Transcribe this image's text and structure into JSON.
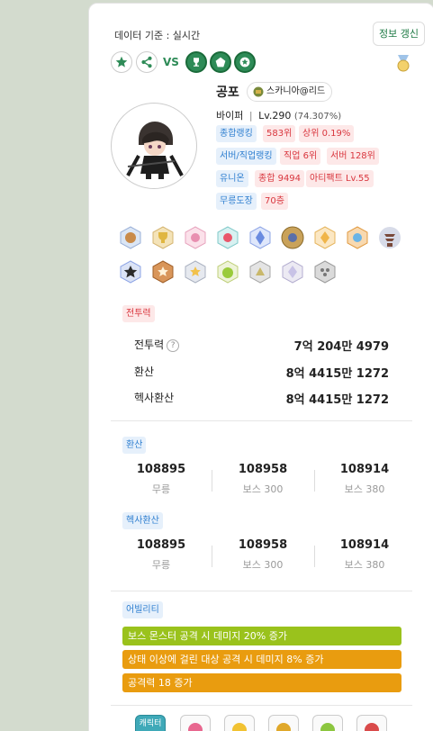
{
  "header": {
    "data_basis": "데이터 기준 : 실시간",
    "refresh_label": "정보 갱신",
    "vs_label": "VS"
  },
  "character": {
    "name": "공포",
    "guild": "스카니아@리드",
    "job": "바이퍼",
    "level": "Lv.290",
    "exp_pct": "(74.307%)"
  },
  "rankings": {
    "overall_label": "종합랭킹",
    "overall_value": "583위",
    "overall_top": "상위 0.19%",
    "server_job_label": "서버/직업랭킹",
    "job_rank": "직업 6위",
    "server_rank": "서버 128위",
    "union_label": "유니온",
    "union_total": "종합 9494",
    "artifact": "아티팩트 Lv.55",
    "dojo_label": "무릉도장",
    "dojo_floor": "70층"
  },
  "combat": {
    "section_label": "전투력",
    "rows": [
      {
        "label": "전투력",
        "value": "7억 204만 4979"
      },
      {
        "label": "환산",
        "value": "8억 4415만 1272"
      },
      {
        "label": "헥사환산",
        "value": "8억 4415만 1272"
      }
    ]
  },
  "hwansan": {
    "section_label": "환산",
    "cols": [
      {
        "value": "108895",
        "label": "무릉"
      },
      {
        "value": "108958",
        "label": "보스 300"
      },
      {
        "value": "108914",
        "label": "보스 380"
      }
    ]
  },
  "hexa": {
    "section_label": "헥사환산",
    "cols": [
      {
        "value": "108895",
        "label": "무릉"
      },
      {
        "value": "108958",
        "label": "보스 300"
      },
      {
        "value": "108914",
        "label": "보스 380"
      }
    ]
  },
  "ability": {
    "section_label": "어빌리티",
    "lines": [
      {
        "text": "보스 몬스터 공격 시 데미지 20% 증가",
        "color": "#9ac21c"
      },
      {
        "text": "상태 이상에 걸린 대상 공격 시 데미지 8% 증가",
        "color": "#e99c0f"
      },
      {
        "text": "공격력 18 증가",
        "color": "#e99c0f"
      }
    ]
  },
  "bottom": {
    "first_slot_label": "캐릭터"
  },
  "colors": {
    "accent_green": "#2e8b57",
    "tag_blue": "#2f7fd0",
    "tag_red": "#d9363e"
  }
}
